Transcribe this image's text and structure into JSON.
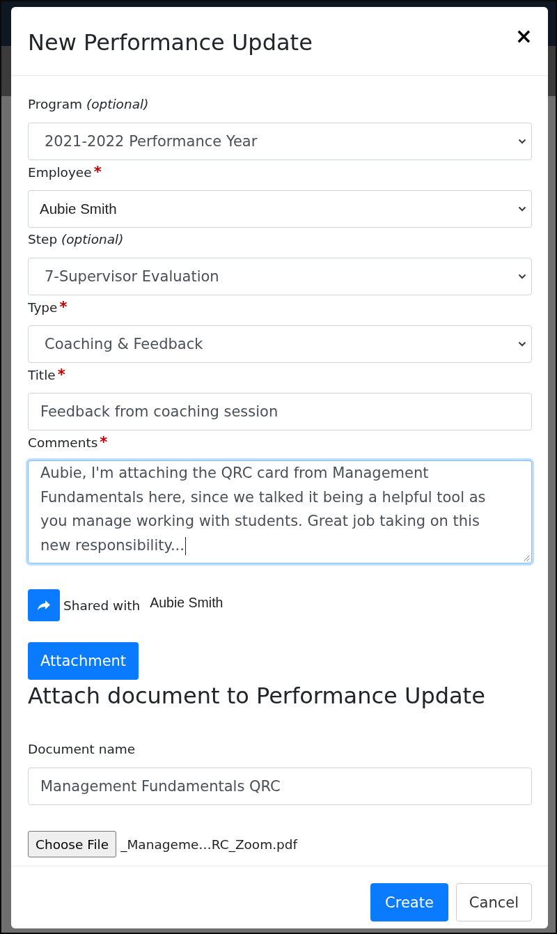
{
  "dialog": {
    "title": "New Performance Update",
    "close": "×"
  },
  "fields": [
    {
      "kind": "select",
      "label": "Program *(optional)*",
      "value": "2021-2022 Performance Year",
      "focused": false
    },
    {
      "kind": "person-select",
      "label": "Employee",
      "required_mark": "*",
      "value": "Aubie Smith",
      "focused": false
    },
    {
      "kind": "select",
      "label": "Step *(optional)*",
      "value": "7-Supervisor Evaluation",
      "focused": false
    },
    {
      "kind": "select",
      "label": "Type",
      "required_mark": "*",
      "value": "Coaching & Feedback",
      "focused": false
    },
    {
      "kind": "text",
      "label": "Title",
      "required_mark": "*",
      "value": "Feedback from coaching session",
      "focused": false
    },
    {
      "kind": "textarea",
      "label": "Comments",
      "required_mark": "*",
      "value": "Aubie, I'm attaching the QRC card from Management Fundamentals here, since we talked it being a helpful tool as you manage working with students. Great job taking on this new responsibility...",
      "focused": true
    }
  ],
  "sharing": {
    "label": "Shared with",
    "recipient": "Aubie Smith"
  },
  "attachment": {
    "button": "Attachment",
    "heading": "Attach document to Performance Update",
    "document_label": "Document name",
    "document_value": "Management Fundamentals QRC",
    "file_button": "Choose File",
    "file_name": "_Manageme…RC_Zoom.pdf"
  },
  "footer_buttons": [
    {
      "kind": "primary",
      "label": "Create"
    },
    {
      "kind": "secondary",
      "label": "Cancel"
    }
  ]
}
